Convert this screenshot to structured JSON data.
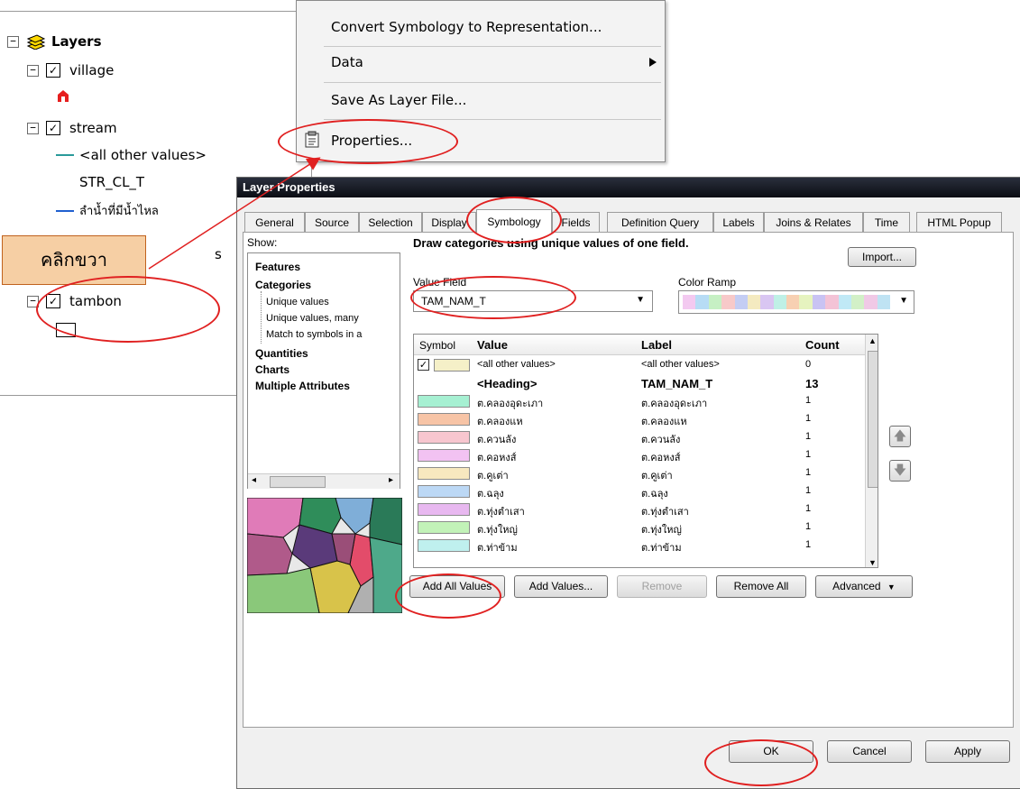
{
  "toc": {
    "root_label": "Layers",
    "layers": [
      {
        "name": "village"
      },
      {
        "name": "stream",
        "legend": [
          {
            "label": "<all other values>"
          },
          {
            "label": "STR_CL_T"
          },
          {
            "label": "ลำน้ำที่มีน้ำไหล"
          }
        ]
      },
      {
        "name": "tambon"
      }
    ]
  },
  "context_menu": {
    "items": [
      {
        "label": "Convert Symbology to Representation..."
      },
      {
        "label": "Data"
      },
      {
        "label": "Save As Layer File..."
      },
      {
        "label": "Properties..."
      }
    ]
  },
  "callout": {
    "label": "คลิกขวา",
    "fill": "#f6cfa4",
    "border": "#c0621e"
  },
  "dialog": {
    "title": "Layer Properties",
    "tabs": [
      "General",
      "Source",
      "Selection",
      "Display",
      "Symbology",
      "Fields",
      "Definition Query",
      "Labels",
      "Joins & Relates",
      "Time",
      "HTML Popup"
    ],
    "active_tab": "Symbology",
    "show_label": "Show:",
    "show_tree": [
      {
        "label": "Features",
        "bold": true
      },
      {
        "label": "Categories",
        "bold": true
      },
      {
        "label": "Unique values",
        "bold": false
      },
      {
        "label": "Unique values, many",
        "bold": false
      },
      {
        "label": "Match to symbols in a",
        "bold": false
      },
      {
        "label": "Quantities",
        "bold": true
      },
      {
        "label": "Charts",
        "bold": true
      },
      {
        "label": "Multiple Attributes",
        "bold": true
      }
    ],
    "description": "Draw categories using unique values of one field.",
    "import_label": "Import...",
    "value_field_label": "Value Field",
    "value_field_value": "TAM_NAM_T",
    "color_ramp_label": "Color Ramp",
    "table_headers": {
      "symbol": "Symbol",
      "value": "Value",
      "label": "Label",
      "count": "Count"
    },
    "rows": [
      {
        "value": "<all other values>",
        "label": "<all other values>",
        "count": "0",
        "color": "#f5f0c8",
        "checked": true
      },
      {
        "value": "<Heading>",
        "label": "TAM_NAM_T",
        "count": "13",
        "heading": true
      },
      {
        "value": "ต.คลองอุดะเภา",
        "label": "ต.คลองอุดะเภา",
        "count": "1",
        "color": "#a6f0d2"
      },
      {
        "value": "ต.คลองแห",
        "label": "ต.คลองแห",
        "count": "1",
        "color": "#f7c4a6"
      },
      {
        "value": "ต.ควนลัง",
        "label": "ต.ควนลัง",
        "count": "1",
        "color": "#f7c6cf"
      },
      {
        "value": "ต.คอหงส์",
        "label": "ต.คอหงส์",
        "count": "1",
        "color": "#f2c2f2"
      },
      {
        "value": "ต.คูเต่า",
        "label": "ต.คูเต่า",
        "count": "1",
        "color": "#f7e8bf"
      },
      {
        "value": "ต.ฉลุง",
        "label": "ต.ฉลุง",
        "count": "1",
        "color": "#bcd8f5"
      },
      {
        "value": "ต.ทุ่งตำเสา",
        "label": "ต.ทุ่งตำเสา",
        "count": "1",
        "color": "#e8b8f0"
      },
      {
        "value": "ต.ทุ่งใหญ่",
        "label": "ต.ทุ่งใหญ่",
        "count": "1",
        "color": "#c2f2b8"
      },
      {
        "value": "ต.ท่าข้าม",
        "label": "ต.ท่าข้าม",
        "count": "1",
        "color": "#bff0ee"
      }
    ],
    "buttons": {
      "add_all": "Add All Values",
      "add_values": "Add Values...",
      "remove": "Remove",
      "remove_all": "Remove All",
      "advanced": "Advanced"
    },
    "footer": {
      "ok": "OK",
      "cancel": "Cancel",
      "apply": "Apply"
    },
    "color_ramp": [
      "#f3c9f0",
      "#b7dcf5",
      "#c6f0c4",
      "#f7c9c9",
      "#c4cdf3",
      "#f4eac0",
      "#d9c6f2",
      "#bff0e6",
      "#f7d0b2",
      "#e6f3bf",
      "#c9c3f3",
      "#f3c3d6",
      "#c0e9f6",
      "#d2f0c7",
      "#f0c9e6",
      "#bfe3f3"
    ],
    "preview_colors": [
      "#e07bb8",
      "#2f8d5a",
      "#7faed8",
      "#5a3a7a",
      "#b05a8a",
      "#2a7a58",
      "#e34c6a",
      "#d8c34a",
      "#4ea98a",
      "#8ac87a",
      "#9a4e78",
      "#b0b0b0"
    ]
  }
}
